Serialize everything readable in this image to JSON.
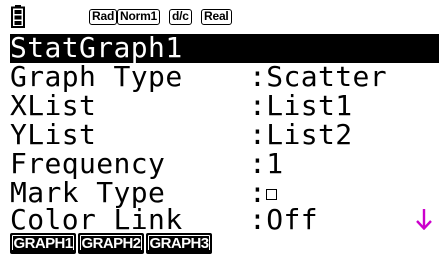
{
  "status_bar": {
    "icon": "battery-icon",
    "badges": [
      "Rad",
      "Norm1",
      "d/c",
      "Real"
    ]
  },
  "menu": {
    "title": "StatGraph1",
    "items": [
      {
        "label": "Graph Type",
        "value": ":Scatter"
      },
      {
        "label": "XList",
        "value": ":List1"
      },
      {
        "label": "YList",
        "value": ":List2"
      },
      {
        "label": "Frequency",
        "value": ":1"
      },
      {
        "label": "Mark Type",
        "value": ":",
        "icon": "square-mark-icon"
      },
      {
        "label": "Color Link",
        "value": ":Off"
      }
    ],
    "scroll_icon": "arrow-down-icon"
  },
  "function_keys": [
    "GRAPH1",
    "GRAPH2",
    "GRAPH3"
  ],
  "colors": {
    "background": "#ffffff",
    "foreground": "#000000",
    "scroll_arrow": "#cc00cc"
  }
}
